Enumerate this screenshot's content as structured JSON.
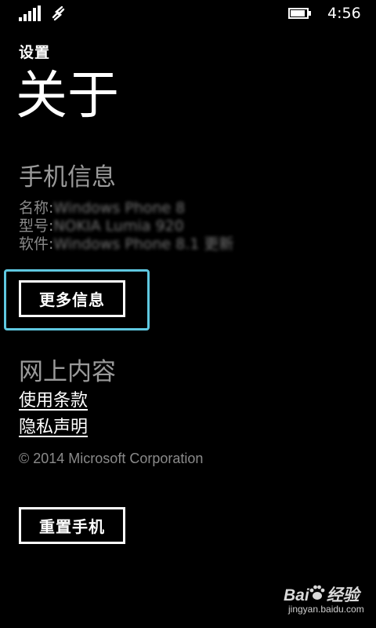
{
  "status_bar": {
    "time": "4:56",
    "signal_icon": "signal-bars-icon",
    "data_icon": "data-connection-icon",
    "battery_icon": "battery-icon"
  },
  "header": {
    "app_title": "设置",
    "page_title": "关于"
  },
  "phone_info": {
    "section_title": "手机信息",
    "rows": [
      {
        "label": "名称:",
        "value": "Windows Phone 8"
      },
      {
        "label": "型号:",
        "value": "NOKIA Lumia 920"
      },
      {
        "label": "软件:",
        "value": "Windows Phone 8.1 更新"
      }
    ],
    "more_info_button": "更多信息"
  },
  "online_content": {
    "section_title": "网上内容",
    "links": [
      "使用条款",
      "隐私声明"
    ],
    "copyright": "© 2014 Microsoft Corporation"
  },
  "reset_button": "重置手机",
  "watermark": {
    "brand_left": "Bai",
    "brand_right": "经验",
    "url": "jingyan.baidu.com"
  },
  "colors": {
    "background": "#000000",
    "text": "#ffffff",
    "secondary_text": "#9a9a9a",
    "highlight": "#5fc8e0"
  }
}
